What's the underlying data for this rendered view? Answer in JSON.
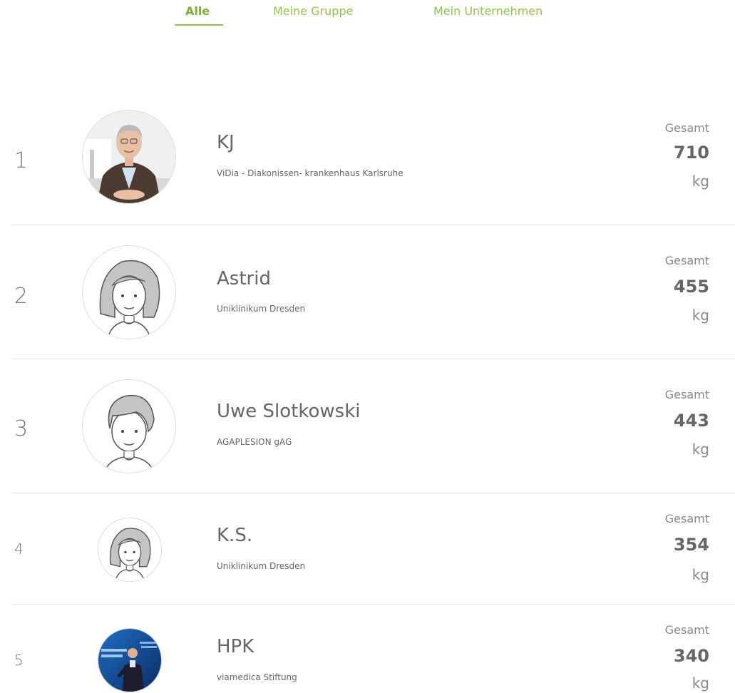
{
  "tabs": [
    {
      "label": "Alle",
      "active": true
    },
    {
      "label": "Meine Gruppe",
      "active": false
    },
    {
      "label": "Mein Unternehmen",
      "active": false
    }
  ],
  "colors": {
    "accent": "#8dc63f",
    "text": "#666666",
    "divider": "#e6e6e6"
  },
  "leaderboard": [
    {
      "rank": "1",
      "name": "KJ",
      "organization": "ViDia - Diakonissen- krankenhaus Karlsruhe",
      "score_label": "Gesamt",
      "score": "710",
      "unit": "kg",
      "avatar": "photo-man-suit"
    },
    {
      "rank": "2",
      "name": "Astrid",
      "organization": "Uniklinikum Dresden",
      "score_label": "Gesamt",
      "score": "455",
      "unit": "kg",
      "avatar": "illustrated-woman"
    },
    {
      "rank": "3",
      "name": "Uwe Slotkowski",
      "organization": "AGAPLESION gAG",
      "score_label": "Gesamt",
      "score": "443",
      "unit": "kg",
      "avatar": "illustrated-man"
    },
    {
      "rank": "4",
      "name": "K.S.",
      "organization": "Uniklinikum Dresden",
      "score_label": "Gesamt",
      "score": "354",
      "unit": "kg",
      "avatar": "illustrated-woman"
    },
    {
      "rank": "5",
      "name": "HPK",
      "organization": "viamedica Stiftung",
      "score_label": "Gesamt",
      "score": "340",
      "unit": "kg",
      "avatar": "photo-speaker-stage"
    }
  ]
}
